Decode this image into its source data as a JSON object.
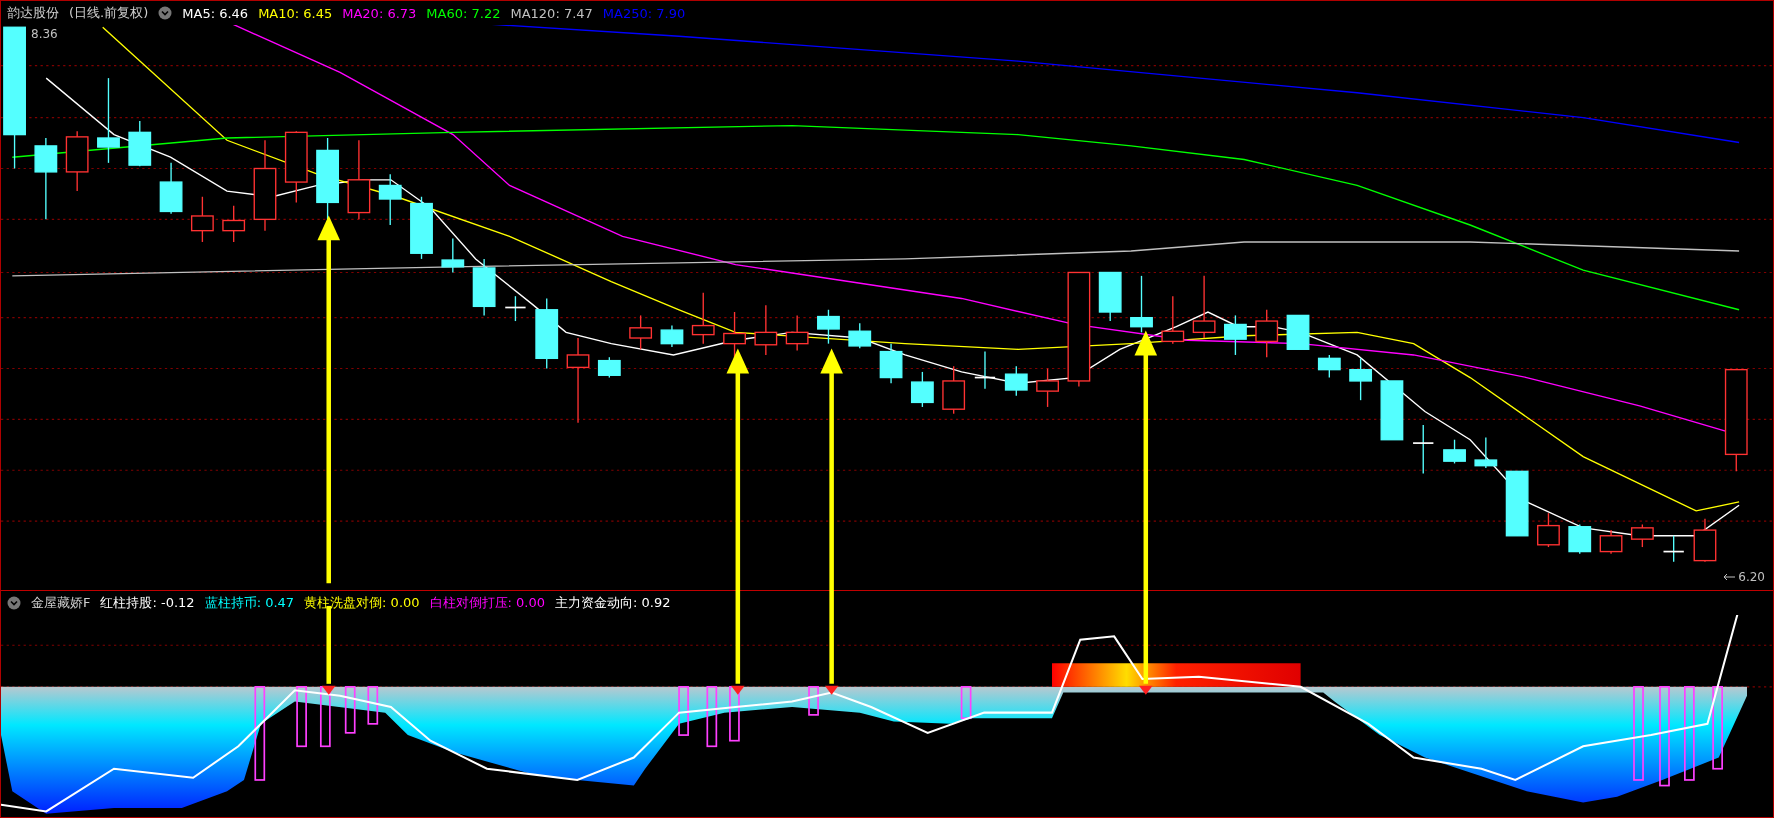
{
  "price_panel": {
    "title": "韵达股份",
    "mode": "(日线.前复权)",
    "moving_averages": [
      {
        "label": "MA5: 6.46",
        "color": "#ffffff"
      },
      {
        "label": "MA10: 6.45",
        "color": "#ffff00"
      },
      {
        "label": "MA20: 6.73",
        "color": "#ff00ff"
      },
      {
        "label": "MA60: 7.22",
        "color": "#00ff00"
      },
      {
        "label": "MA120: 7.47",
        "color": "#c0c0c0"
      },
      {
        "label": "MA250: 7.90",
        "color": "#0000ff"
      }
    ],
    "high_label": "8.36",
    "low_label": "6.20"
  },
  "indicator_panel": {
    "name": "金屋藏娇F",
    "items": [
      {
        "label": "红柱持股: -0.12",
        "color": "#ffffff"
      },
      {
        "label": "蓝柱持币: 0.47",
        "color": "#00ffff"
      },
      {
        "label": "黄柱洗盘对倒: 0.00",
        "color": "#ffff00"
      },
      {
        "label": "白柱对倒打压: 0.00",
        "color": "#ff00ff"
      },
      {
        "label": "主力资金动向: 0.92",
        "color": "#ffffff"
      }
    ]
  }
}
